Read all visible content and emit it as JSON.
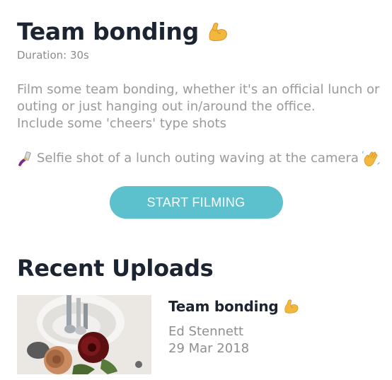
{
  "challenge": {
    "title": "Team bonding",
    "title_icon": "flexed-biceps-emoji",
    "duration": "Duration: 30s",
    "description": "Film some team bonding, whether it's an official lunch or outing or just hanging out in/around the office. Include some 'cheers' type shots",
    "description_lines": [
      "Film some team bonding, whether it's an official lunch or",
      "outing or just hanging out in/around the office.",
      "Include some 'cheers' type shots"
    ],
    "task": {
      "leading_icon": "selfie-emoji",
      "text": "Selfie shot of a lunch outing waving at the camera",
      "trailing_icon": "waving-hand-emoji"
    },
    "start_button_label": "START FILMING"
  },
  "recent_uploads": {
    "heading": "Recent Uploads",
    "items": [
      {
        "title": "Team bonding",
        "title_icon": "flexed-biceps-emoji",
        "uploader": "Ed Stennett",
        "date": "29 Mar 2018",
        "thumbnail": "flowers-and-cutlery-photo"
      }
    ]
  },
  "colors": {
    "accent": "#5cc1cc",
    "heading": "#1b2430",
    "muted": "#9a9a9a",
    "emoji_yellow": "#f4b73e"
  }
}
